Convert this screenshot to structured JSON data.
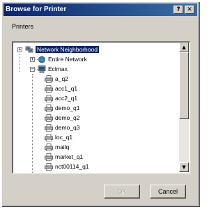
{
  "dialog": {
    "title": "Browse for Printer",
    "help_glyph": "?",
    "close_glyph": "✕",
    "prompt": "Printers",
    "ok_label": "OK",
    "cancel_label": "Cancel"
  },
  "tree": {
    "expand_glyph": "+",
    "collapse_glyph": "−",
    "nodes": [
      {
        "label": "Network Neighborhood",
        "icon": "network-neighborhood-icon"
      },
      {
        "label": "Entire Network",
        "icon": "globe-icon"
      },
      {
        "label": "Eclmax",
        "icon": "computer-icon"
      },
      {
        "label": "a_q2",
        "icon": "printer-icon"
      },
      {
        "label": "acc1_q1",
        "icon": "printer-icon"
      },
      {
        "label": "acc2_q1",
        "icon": "printer-icon"
      },
      {
        "label": "demo_q1",
        "icon": "printer-icon"
      },
      {
        "label": "demo_q2",
        "icon": "printer-icon"
      },
      {
        "label": "demo_q3",
        "icon": "printer-icon"
      },
      {
        "label": "loc_q1",
        "icon": "printer-icon"
      },
      {
        "label": "mailq",
        "icon": "printer-icon"
      },
      {
        "label": "market_q1",
        "icon": "printer-icon"
      },
      {
        "label": "nct00114_q1",
        "icon": "printer-icon"
      }
    ]
  },
  "scrollbar": {
    "up_glyph": "▲",
    "down_glyph": "▼"
  }
}
